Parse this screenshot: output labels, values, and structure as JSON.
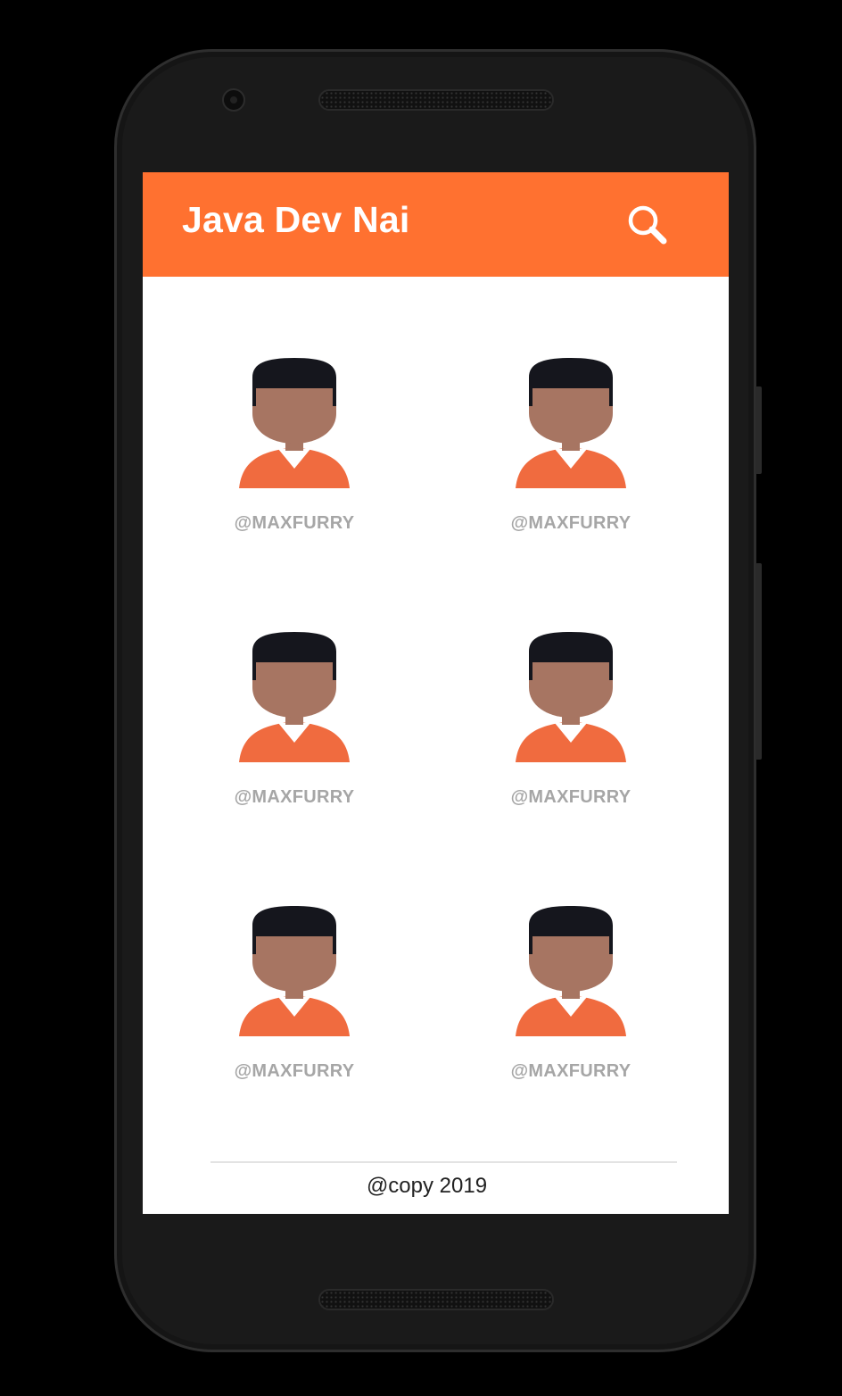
{
  "app": {
    "title": "Java Dev Nai"
  },
  "toolbar": {
    "search_icon": "search-icon"
  },
  "profiles": [
    {
      "handle": "@MAXFURRY",
      "avatar_icon": "user-avatar-icon"
    },
    {
      "handle": "@MAXFURRY",
      "avatar_icon": "user-avatar-icon"
    },
    {
      "handle": "@MAXFURRY",
      "avatar_icon": "user-avatar-icon"
    },
    {
      "handle": "@MAXFURRY",
      "avatar_icon": "user-avatar-icon"
    },
    {
      "handle": "@MAXFURRY",
      "avatar_icon": "user-avatar-icon"
    },
    {
      "handle": "@MAXFURRY",
      "avatar_icon": "user-avatar-icon"
    }
  ],
  "footer": {
    "text": "@copy 2019"
  },
  "colors": {
    "accent": "#ff7130",
    "hair": "#15161d",
    "skin": "#a77562",
    "shirt": "#f06b3f",
    "handle_text": "#a6a6a6",
    "background": "#ffffff"
  }
}
